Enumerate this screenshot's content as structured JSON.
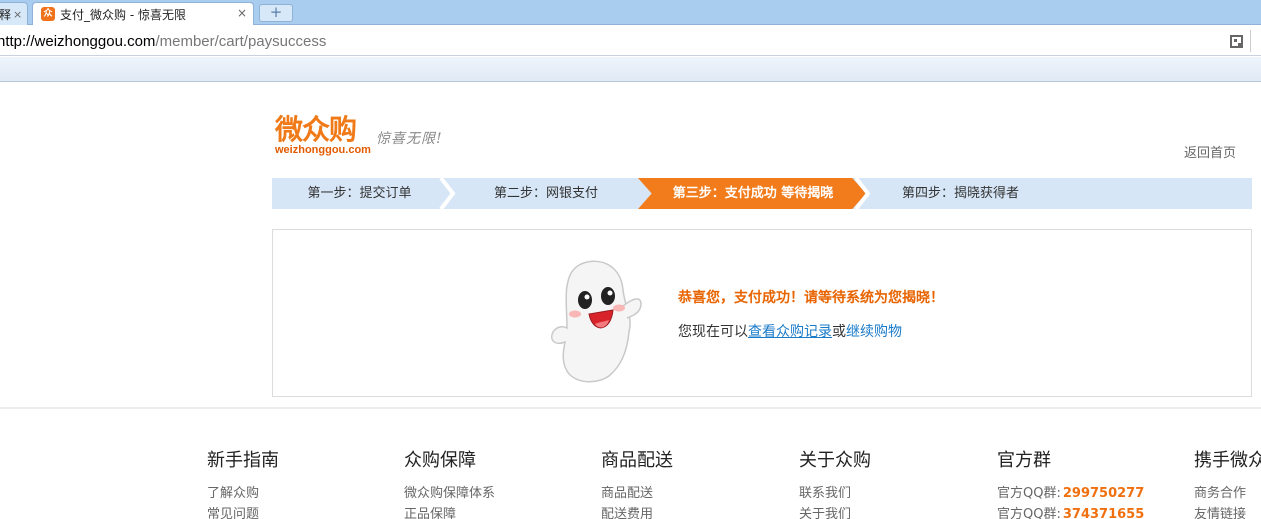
{
  "browser": {
    "tabs": [
      {
        "label": "释",
        "active": false
      },
      {
        "label": "支付_微众购 - 惊喜无限",
        "active": true
      }
    ],
    "favicon_text": "众",
    "close_glyph": "×",
    "newtab_glyph": "+",
    "url_host": "http://weizhonggou.com",
    "url_path": "/member/cart/paysuccess"
  },
  "header": {
    "logo_text": "微众购",
    "logo_domain": "weizhonggou.com",
    "slogan": "惊喜无限!",
    "home_link": "返回首页"
  },
  "steps": [
    {
      "label": "第一步：提交订单",
      "active": false
    },
    {
      "label": "第二步：网银支付",
      "active": false
    },
    {
      "label": "第三步：支付成功 等待揭晓",
      "active": true
    },
    {
      "label": "第四步：揭晓获得者",
      "active": false
    }
  ],
  "result": {
    "title": "恭喜您，支付成功！请等待系统为您揭晓！",
    "prefix": "您现在可以",
    "link_records": "查看众购记录",
    "conjunction": "或",
    "link_continue": "继续购物"
  },
  "footer": {
    "columns": [
      {
        "title": "新手指南",
        "links": [
          "了解众购",
          "常见问题"
        ]
      },
      {
        "title": "众购保障",
        "links": [
          "微众购保障体系",
          "正品保障"
        ]
      },
      {
        "title": "商品配送",
        "links": [
          "商品配送",
          "配送费用"
        ]
      },
      {
        "title": "关于众购",
        "links": [
          "联系我们",
          "关于我们"
        ]
      },
      {
        "title": "官方群",
        "qq_label": "官方QQ群:",
        "qq_numbers": [
          "299750277",
          "374371655"
        ]
      },
      {
        "title": "携手微众",
        "links": [
          "商务合作",
          "友情链接"
        ]
      }
    ]
  },
  "colors": {
    "accent": "#f27c1c",
    "step_bg": "#d6e6f7",
    "link": "#1a7bc8"
  }
}
